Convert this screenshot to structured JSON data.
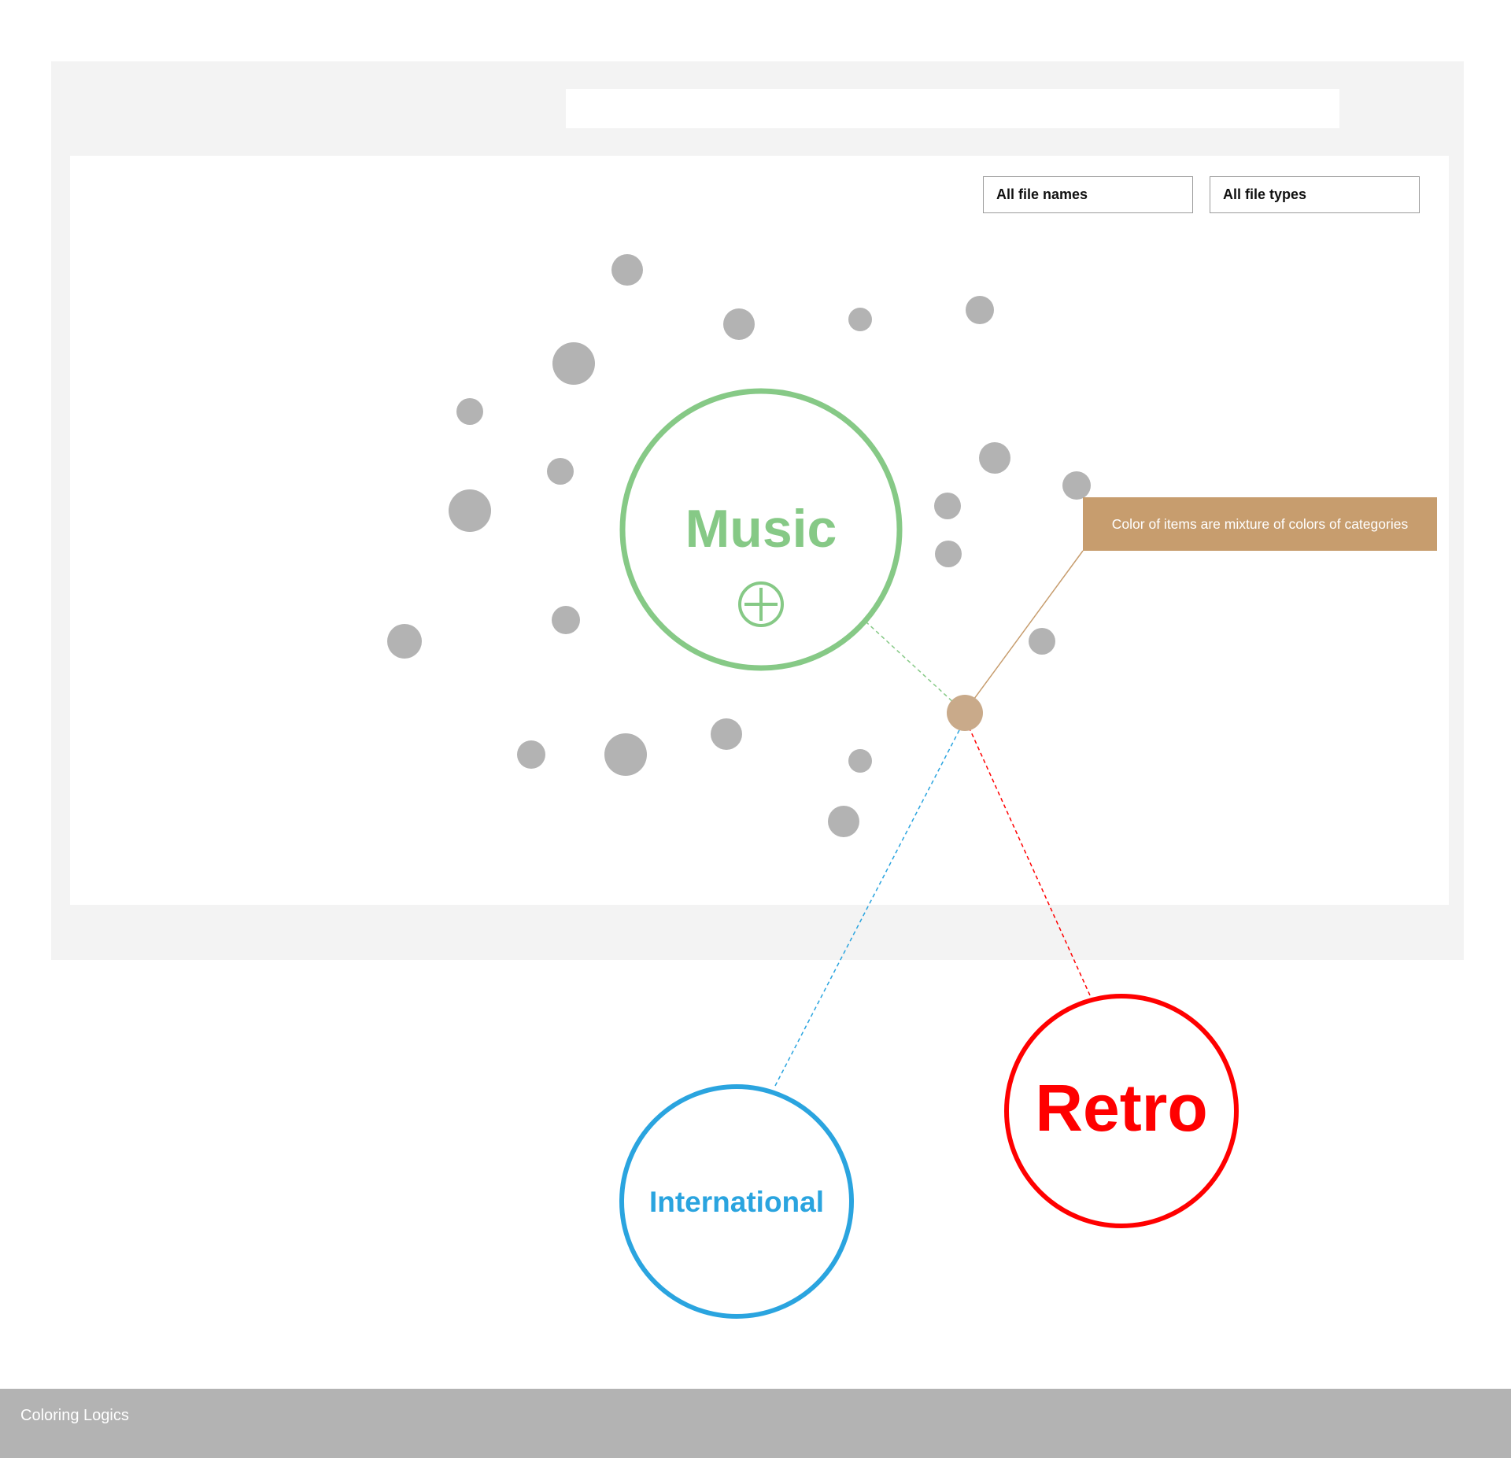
{
  "search": {
    "value": ""
  },
  "filters": {
    "file_names": "All file names",
    "file_types": "All file types"
  },
  "categories": {
    "music": {
      "label": "Music",
      "color": "#86c986",
      "add_icon": "plus-circle-icon"
    },
    "international": {
      "label": "International",
      "color": "#2aa4df"
    },
    "retro": {
      "label": "Retro",
      "color": "#ff0000"
    }
  },
  "item_colors": {
    "default": "#b3b3b3",
    "mixed": "#c9aa8a"
  },
  "annotation": {
    "text": "Color of items are mixture of colors of categories",
    "color": "#c79d6e"
  },
  "footer": {
    "label": "Coloring Logics"
  }
}
